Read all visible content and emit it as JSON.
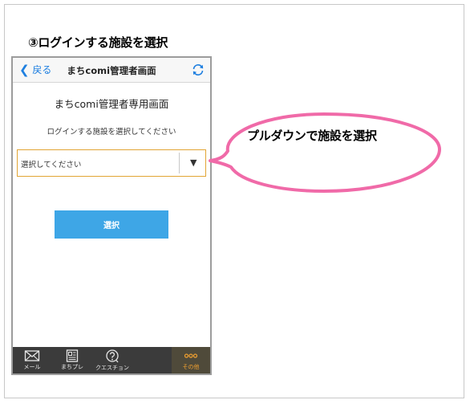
{
  "step_title": "③ログインする施設を選択",
  "nav": {
    "back_label": "戻る",
    "title": "まちcomi管理者画面"
  },
  "screen": {
    "title": "まちcomi管理者専用画面",
    "instruction": "ログインする施設を選択してください",
    "select_value": "選択してください",
    "select_button": "選択"
  },
  "tabs": [
    {
      "label": "メール",
      "icon": "mail-icon"
    },
    {
      "label": "まちプレ",
      "icon": "newspaper-icon"
    },
    {
      "label": "クエスチョン",
      "icon": "question-icon"
    },
    {
      "label": "その他",
      "icon": "more-icon",
      "active": true
    }
  ],
  "callout": {
    "text": "プルダウンで施設を選択"
  },
  "colors": {
    "accent_blue": "#3ea6e6",
    "nav_link": "#1e7fe0",
    "select_border": "#e2a534",
    "callout_border": "#f06aa8",
    "tab_active": "#f0a030"
  }
}
